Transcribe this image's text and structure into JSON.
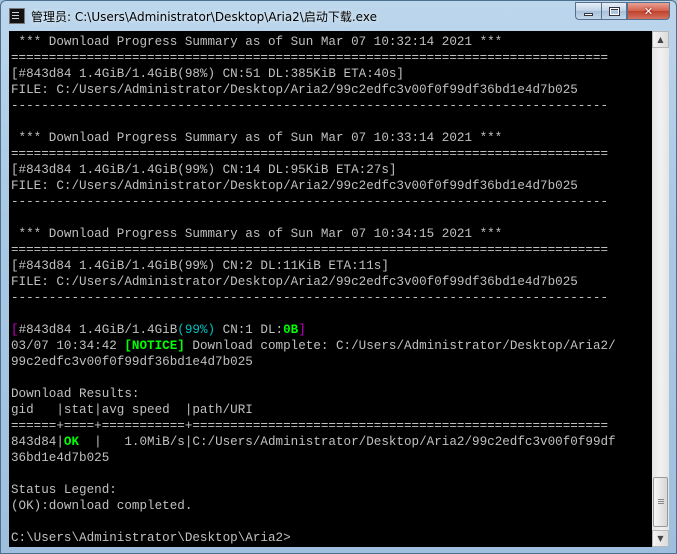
{
  "window": {
    "title": "管理员: C:\\Users\\Administrator\\Desktop\\Aria2\\启动下载.exe",
    "controls": {
      "minimize": "minimize",
      "maximize": "maximize",
      "close": "✕"
    }
  },
  "console": {
    "lines": [
      " *** Download Progress Summary as of Sun Mar 07 10:32:14 2021 ***",
      "===============================================================================",
      "[#843d84 1.4GiB/1.4GiB(98%) CN:51 DL:385KiB ETA:40s]",
      "FILE: C:/Users/Administrator/Desktop/Aria2/99c2edfc3v00f0f99df36bd1e4d7b025",
      "-------------------------------------------------------------------------------",
      "",
      " *** Download Progress Summary as of Sun Mar 07 10:33:14 2021 ***",
      "===============================================================================",
      "[#843d84 1.4GiB/1.4GiB(99%) CN:14 DL:95KiB ETA:27s]",
      "FILE: C:/Users/Administrator/Desktop/Aria2/99c2edfc3v00f0f99df36bd1e4d7b025",
      "-------------------------------------------------------------------------------",
      "",
      " *** Download Progress Summary as of Sun Mar 07 10:34:15 2021 ***",
      "===============================================================================",
      "[#843d84 1.4GiB/1.4GiB(99%) CN:2 DL:11KiB ETA:11s]",
      "FILE: C:/Users/Administrator/Desktop/Aria2/99c2edfc3v00f0f99df36bd1e4d7b025",
      "-------------------------------------------------------------------------------",
      "",
      null,
      null,
      "99c2edfc3v00f0f99df36bd1e4d7b025",
      "",
      "Download Results:",
      "gid   |stat|avg speed  |path/URI",
      "======+====+===========+=======================================================",
      null,
      "36bd1e4d7b025",
      "",
      "Status Legend:",
      "(OK):download completed.",
      "",
      "C:\\Users\\Administrator\\Desktop\\Aria2>"
    ],
    "progress_line": {
      "bracket_open": "[",
      "stats": "#843d84 1.4GiB/1.4GiB",
      "percent": "(99%)",
      "cn": " CN:1 DL:",
      "dl": "0B",
      "bracket_close": "]"
    },
    "notice_line": {
      "time": "03/07 10:34:42 ",
      "tag": "[NOTICE]",
      "message": " Download complete: C:/Users/Administrator/Desktop/Aria2/"
    },
    "result_row": {
      "gid": "843d84|",
      "stat": "OK",
      "rest": "  |   1.0MiB/s|C:/Users/Administrator/Desktop/Aria2/99c2edfc3v00f0f99df"
    }
  },
  "colors": {
    "console_bg": "#000000",
    "console_text": "#c0c0c0",
    "ok_green": "#00ff00",
    "percent_cyan": "#00c0c0",
    "bracket_magenta": "#c000c0"
  }
}
